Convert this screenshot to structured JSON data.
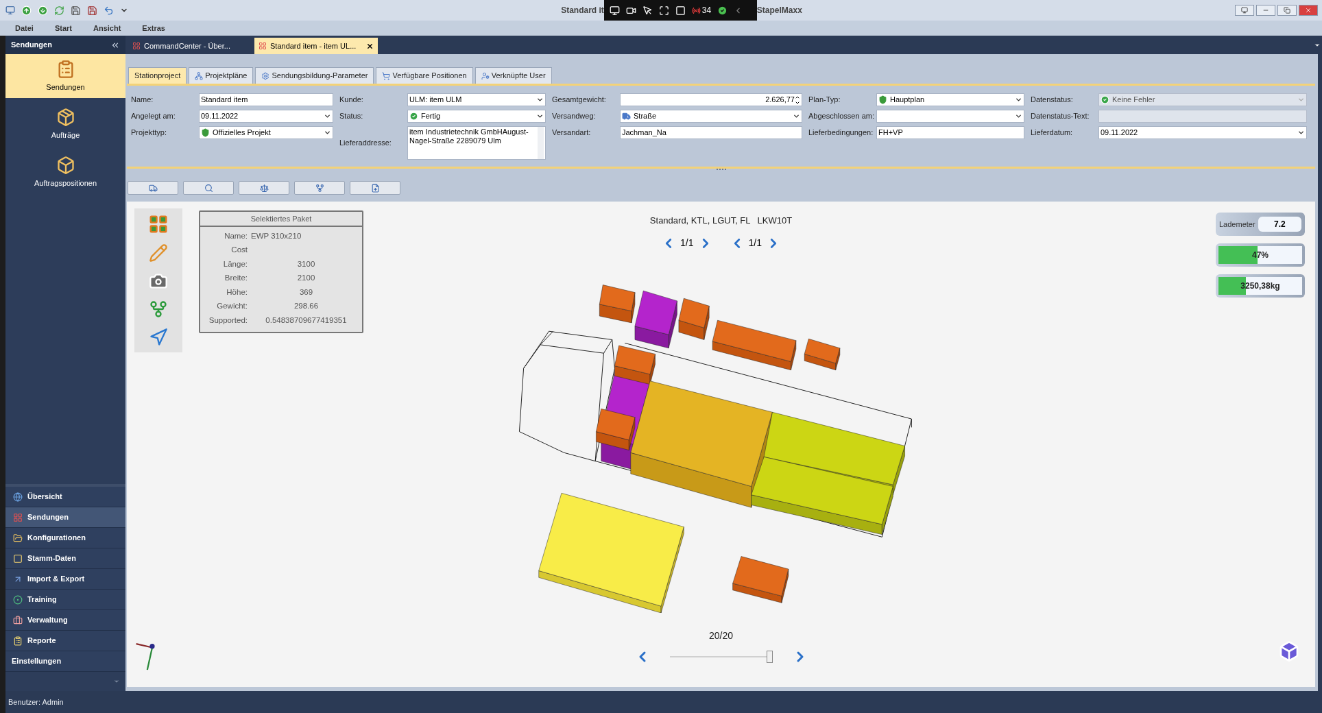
{
  "title_bar": {
    "title_left": "Standard it",
    "title_right": "StapelMaxx"
  },
  "recorder_toolbar": {
    "count": "34"
  },
  "menu": [
    "Datei",
    "Start",
    "Ansicht",
    "Extras"
  ],
  "sidebar": {
    "title": "Sendungen",
    "big_items": [
      {
        "label": "Sendungen",
        "selected": true
      },
      {
        "label": "Aufträge",
        "selected": false
      },
      {
        "label": "Auftragspositionen",
        "selected": false
      }
    ],
    "nav": [
      {
        "label": "Übersicht",
        "selected": false,
        "kind": "item"
      },
      {
        "label": "Sendungen",
        "selected": true,
        "kind": "item"
      },
      {
        "label": "Konfigurationen",
        "selected": false,
        "kind": "item"
      },
      {
        "label": "Stamm-Daten",
        "selected": false,
        "kind": "item"
      },
      {
        "label": "Import & Export",
        "selected": false,
        "kind": "item"
      },
      {
        "label": "Training",
        "selected": false,
        "kind": "item"
      },
      {
        "label": "Verwaltung",
        "selected": false,
        "kind": "item"
      },
      {
        "label": "Reporte",
        "selected": false,
        "kind": "item"
      },
      {
        "label": "Einstellungen",
        "selected": false,
        "kind": "section"
      }
    ]
  },
  "doc_tabs": [
    {
      "label": "CommandCenter - Über...",
      "selected": false,
      "closable": false
    },
    {
      "label": "Standard item - item UL...",
      "selected": true,
      "closable": true
    }
  ],
  "form_tabs": [
    {
      "label": "Stationproject",
      "selected": true
    },
    {
      "label": "Projektpläne",
      "selected": false
    },
    {
      "label": "Sendungsbildung-Parameter",
      "selected": false
    },
    {
      "label": "Verfügbare Positionen",
      "selected": false
    },
    {
      "label": "Verknüpfte User",
      "selected": false
    }
  ],
  "form_columns": [
    [
      {
        "label": "Name:",
        "value": "Standard item",
        "kind": "text",
        "disabled": false
      },
      {
        "label": "Angelegt am:",
        "value": "09.11.2022",
        "kind": "dropdown",
        "disabled": false
      },
      {
        "label": "Projekttyp:",
        "value": "Offizielles Projekt",
        "kind": "dropdown",
        "disabled": false
      }
    ],
    [
      {
        "label": "Kunde:",
        "value": "ULM: item ULM",
        "kind": "dropdown",
        "disabled": false
      },
      {
        "label": "Status:",
        "value": "Fertig",
        "kind": "dropdown",
        "disabled": false
      },
      {
        "label": "Lieferaddresse:",
        "value": "item Industrietechnik GmbHAugust-Nagel-Straße 2289079 Ulm",
        "kind": "memo",
        "disabled": false
      }
    ],
    [
      {
        "label": "Gesamtgewicht:",
        "value": "2.626,77",
        "kind": "spin",
        "disabled": false
      },
      {
        "label": "Versandweg:",
        "value": "Straße",
        "kind": "dropdown",
        "disabled": false
      },
      {
        "label": "Versandart:",
        "value": "Jachman_Na",
        "kind": "text",
        "disabled": false
      }
    ],
    [
      {
        "label": "Plan-Typ:",
        "value": "Hauptplan",
        "kind": "dropdown",
        "disabled": false
      },
      {
        "label": "Abgeschlossen am:",
        "kind": "dropdown",
        "disabled": false
      },
      {
        "label": "Lieferbedingungen:",
        "value": "FH+VP",
        "kind": "text",
        "disabled": false
      }
    ],
    [
      {
        "label": "Datenstatus:",
        "value": "Keine Fehler",
        "kind": "dropdown",
        "disabled": true
      },
      {
        "label": "Datenstatus-Text:",
        "kind": "text",
        "disabled": true
      },
      {
        "label": "Lieferdatum:",
        "value": "09.11.2022",
        "kind": "dropdown",
        "disabled": false
      }
    ]
  ],
  "viewer": {
    "info_panel": {
      "title": "Selektiertes Paket",
      "rows": [
        {
          "label": "Name:",
          "value": "EWP 310x210",
          "kind": "inline"
        },
        {
          "label": "Cost",
          "kind": "number"
        },
        {
          "label": "Länge:",
          "value": "3100",
          "kind": "number"
        },
        {
          "label": "Breite:",
          "value": "2100",
          "kind": "number"
        },
        {
          "label": "Höhe:",
          "value": "369",
          "kind": "number"
        },
        {
          "label": "Gewicht:",
          "value": "298.66",
          "kind": "number"
        },
        {
          "label": "Supported:",
          "value": "0.54838709677419351",
          "kind": "number"
        }
      ]
    },
    "scene_title": [
      "Standard, KTL, LGUT, FL",
      "LKW10T"
    ],
    "pagers": [
      {
        "page": "1/1"
      },
      {
        "page": "1/1"
      }
    ],
    "lademeter": {
      "label": "Lademeter",
      "value": "7.2"
    },
    "meters": [
      {
        "reading": "47%",
        "level": 0.47
      },
      {
        "reading": "3250,38kg",
        "level": 0.33
      }
    ],
    "step": {
      "reading": "20/20",
      "level": 1
    }
  },
  "status_bar": "Benutzer: Admin"
}
